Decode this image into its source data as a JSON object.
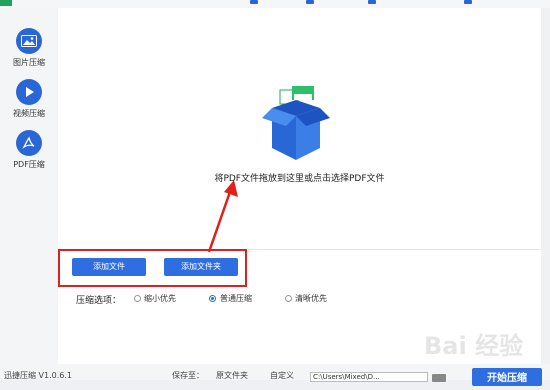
{
  "sidebar": {
    "items": [
      {
        "label": "图片压缩",
        "icon": "image-icon"
      },
      {
        "label": "视频压缩",
        "icon": "play-icon"
      },
      {
        "label": "PDF压缩",
        "icon": "pdf-icon"
      }
    ]
  },
  "main": {
    "drop_text": "将PDF文件拖放到这里或点击选择PDF文件",
    "add_file_label": "添加文件",
    "add_folder_label": "添加文件夹",
    "options_label": "压缩选项：",
    "options": [
      {
        "label": "缩小优先",
        "selected": false
      },
      {
        "label": "普通压缩",
        "selected": true
      },
      {
        "label": "清晰优先",
        "selected": false
      }
    ]
  },
  "bottom": {
    "version": "迅捷压缩 V1.0.6.1",
    "save_to": "保存至：",
    "option_original": "原文件夹",
    "option_custom": "自定义",
    "path": "C:\\Users\\Mixed\\D...",
    "start_label": "开始压缩"
  },
  "watermark": {
    "text": "Bai 经验"
  },
  "colors": {
    "accent": "#2f6ee0",
    "highlight": "#e0201a",
    "box_blue": "#2a67d6"
  }
}
